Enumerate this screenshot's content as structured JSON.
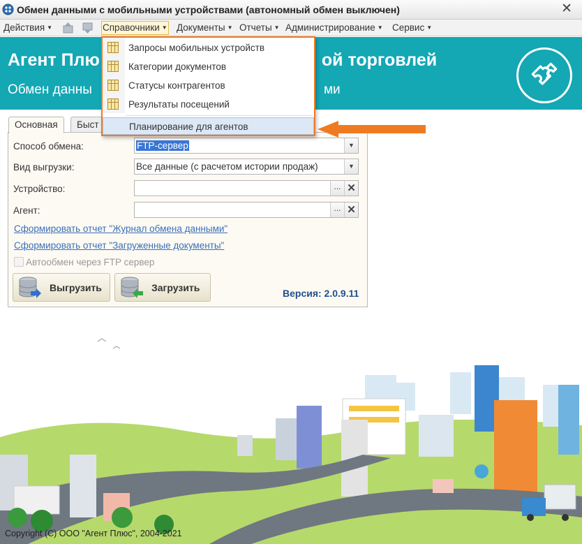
{
  "window": {
    "title": "Обмен данными с мобильными устройствами (автономный обмен выключен)",
    "close_glyph": "✕"
  },
  "menubar": {
    "items": [
      {
        "label": "Действия"
      },
      {
        "label": "Справочники"
      },
      {
        "label": "Документы"
      },
      {
        "label": "Отчеты"
      },
      {
        "label": "Администрирование"
      },
      {
        "label": "Сервис"
      }
    ],
    "toolbar_icons": [
      "upload-icon",
      "download-icon"
    ],
    "active_item": "Справочники"
  },
  "banner": {
    "title_left": "Агент Плю",
    "title_right": "ой торговлей",
    "subtitle_left": "Обмен данны",
    "subtitle_right": "ми",
    "background_color": "#14a7b4",
    "logo_icon": "puzzle-icon"
  },
  "dropdown": {
    "items": [
      {
        "label": "Запросы мобильных устройств",
        "icon": "table-icon"
      },
      {
        "label": "Категории документов",
        "icon": "table-icon"
      },
      {
        "label": "Статусы контрагентов",
        "icon": "table-icon"
      },
      {
        "label": "Результаты посещений",
        "icon": "table-icon"
      }
    ],
    "highlighted_item": "Планирование для агентов",
    "border_color": "#f07a22"
  },
  "tabs": [
    {
      "label": "Основная",
      "active": true
    },
    {
      "label": "Быст",
      "active": false
    }
  ],
  "form": {
    "exchange_method": {
      "label": "Способ обмена:",
      "value": "FTP-сервер"
    },
    "export_type": {
      "label": "Вид выгрузки:",
      "value": "Все данные (с расчетом истории продаж)"
    },
    "device": {
      "label": "Устройство:",
      "value": ""
    },
    "agent": {
      "label": "Агент:",
      "value": ""
    },
    "link_exchange_log": "Сформировать отчет \"Журнал обмена данными\"",
    "link_loaded_docs": "Сформировать отчет \"Загруженные документы\"",
    "auto_exchange_label": "Автообмен через FTP сервер",
    "auto_exchange_checked": false,
    "upload_button": "Выгрузить",
    "download_button": "Загрузить",
    "version": "Версия: 2.0.9.11"
  },
  "footer": {
    "copyright": "Copyright (C) ООО \"Агент Плюс\", 2004-2021"
  }
}
